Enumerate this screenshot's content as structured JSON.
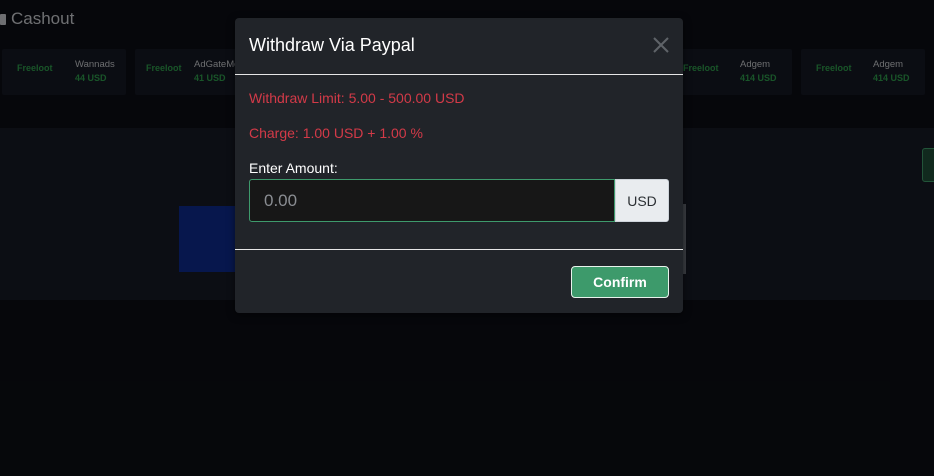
{
  "header": {
    "title": "Cashout",
    "icon": "wallet-icon"
  },
  "ticker": [
    {
      "brand": "Freeloot",
      "name": "Wannads",
      "amount": "44 USD"
    },
    {
      "brand": "Freeloot",
      "name": "AdGateMe",
      "amount": "41 USD"
    },
    {
      "brand": "Freeloot",
      "name": "",
      "amount": ""
    },
    {
      "brand": "Freeloot",
      "name": "Adgem",
      "amount": "414 USD"
    },
    {
      "brand": "Freeloot",
      "name": "Adgem",
      "amount": "414 USD"
    }
  ],
  "modal": {
    "title": "Withdraw Via Paypal",
    "close_icon": "close-icon",
    "limit": "Withdraw Limit: 5.00 - 500.00 USD",
    "charge": "Charge: 1.00 USD + 1.00 %",
    "amount_label": "Enter Amount:",
    "amount_placeholder": "0.00",
    "currency": "USD",
    "confirm_label": "Confirm"
  },
  "colors": {
    "accent_green": "#3d9a6b",
    "error_red": "#d33a48",
    "brand_green": "#2f9b4b",
    "modal_bg": "#212429"
  }
}
